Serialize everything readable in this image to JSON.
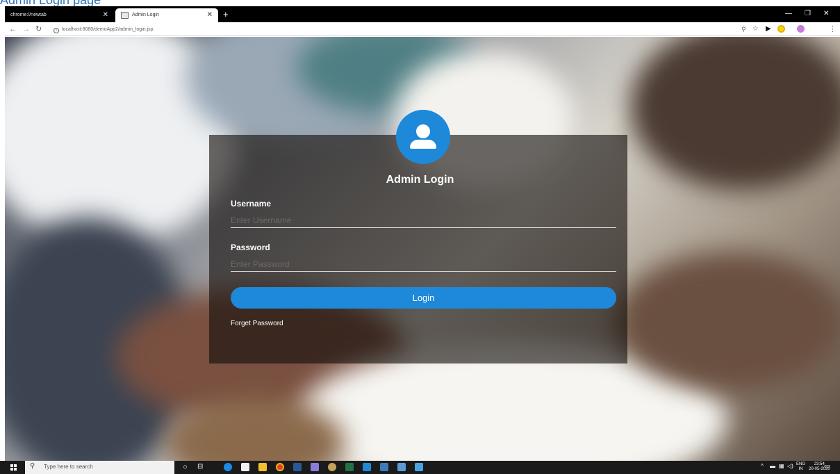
{
  "document": {
    "caption": "Admin Login page"
  },
  "browser": {
    "tabs": [
      {
        "label": "chrome://newtab"
      },
      {
        "label": "Admin Login"
      }
    ],
    "new_tab": "+",
    "url": "localhost:8080/demoApp2/admin_login.jsp"
  },
  "login": {
    "title": "Admin Login",
    "username_label": "Username",
    "username_placeholder": "Enter Username",
    "password_label": "Password",
    "password_placeholder": "Enter Password",
    "login_button": "Login",
    "forget_link": "Forget Password"
  },
  "taskbar": {
    "search_placeholder": "Type here to search",
    "language": "ENG",
    "region": "IN",
    "time": "23:54",
    "date": "20-05-2020"
  },
  "colors": {
    "accent": "#1e88d9",
    "card": "rgba(20,14,12,0.62)"
  }
}
